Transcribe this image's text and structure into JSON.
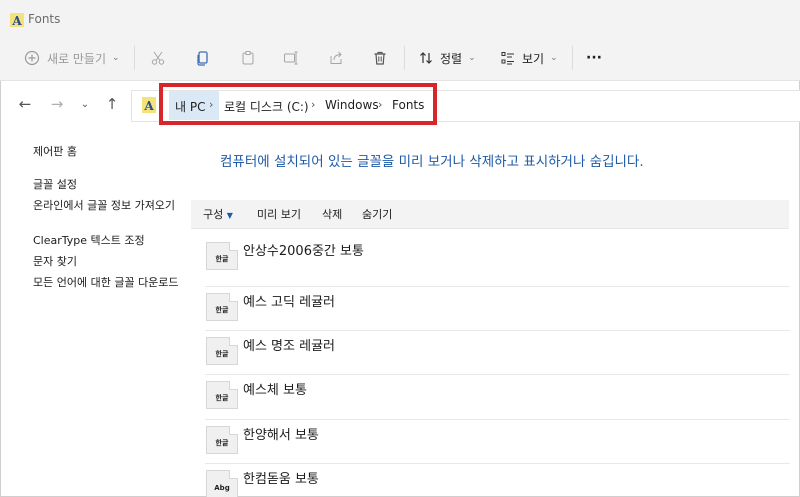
{
  "window": {
    "title": "Fonts"
  },
  "toolbar": {
    "new_label": "새로 만들기",
    "sort_label": "정렬",
    "view_label": "보기",
    "more_label": "···"
  },
  "address": {
    "crumbs": [
      "내 PC",
      "로컬 디스크 (C:)",
      "Windows",
      "Fonts"
    ]
  },
  "sidebar": {
    "items": [
      "제어판 홈",
      "글꼴 설정",
      "온라인에서 글꼴 정보 가져오기",
      "ClearType 텍스트 조정",
      "문자 찾기",
      "모든 언어에 대한 글꼴 다운로드"
    ]
  },
  "main": {
    "description": "컴퓨터에 설치되어 있는 글꼴을 미리 보거나 삭제하고 표시하거나 숨깁니다.",
    "commands": [
      "구성",
      "미리 보기",
      "삭제",
      "숨기기"
    ],
    "fonts": [
      {
        "name": "안상수2006중간 보통",
        "preview": "한글"
      },
      {
        "name": "예스 고딕 레귤러",
        "preview": "한글"
      },
      {
        "name": "예스 명조 레귤러",
        "preview": "한글"
      },
      {
        "name": "예스체 보통",
        "preview": "한글"
      },
      {
        "name": "한양해서 보통",
        "preview": "한글"
      },
      {
        "name": "한컴돋움 보통",
        "preview": "Abg"
      }
    ]
  },
  "annotation": {
    "color": "#d6252b"
  }
}
